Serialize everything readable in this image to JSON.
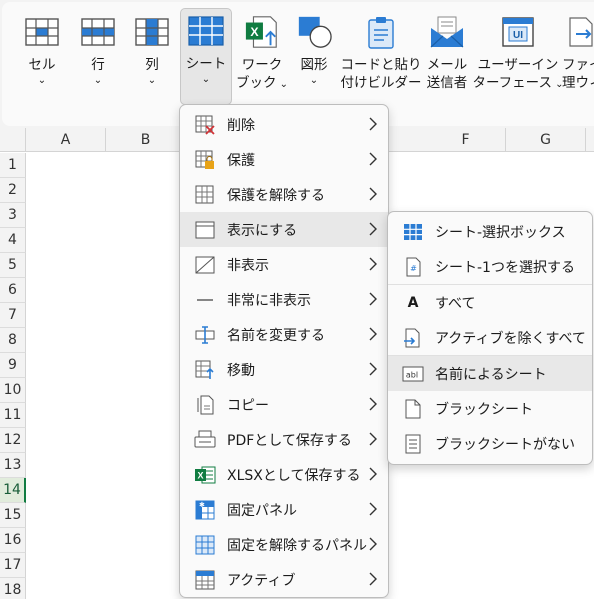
{
  "ribbon": {
    "buttons": [
      {
        "label": "セル",
        "has_dropdown": true
      },
      {
        "label": "行",
        "has_dropdown": true
      },
      {
        "label": "列",
        "has_dropdown": true
      },
      {
        "label": "シート",
        "has_dropdown": true,
        "active": true
      },
      {
        "label1": "ワーク",
        "label2": "ブック",
        "has_dropdown": true
      },
      {
        "label": "図形",
        "has_dropdown": true
      },
      {
        "label1": "コードと貼り",
        "label2": "付けビルダー"
      },
      {
        "label1": "メール",
        "label2": "送信者"
      },
      {
        "label1": "ユーザーイン",
        "label2": "ターフェース",
        "has_dropdown": true
      },
      {
        "label1": "ファイ",
        "label2": "理ウィ"
      }
    ]
  },
  "grid": {
    "columns": [
      "A",
      "B",
      "",
      "",
      "F",
      "G"
    ],
    "rows": [
      "1",
      "2",
      "3",
      "4",
      "5",
      "6",
      "7",
      "8",
      "9",
      "10",
      "11",
      "12",
      "13",
      "14",
      "15",
      "16",
      "17",
      "18"
    ],
    "selected_row": "14"
  },
  "sheet_menu": {
    "items": [
      {
        "label": "削除",
        "icon": "delete-sheet-icon"
      },
      {
        "label": "保護",
        "icon": "protect-sheet-icon"
      },
      {
        "label": "保護を解除する",
        "icon": "unprotect-sheet-icon"
      },
      {
        "label": "表示にする",
        "icon": "show-sheet-icon",
        "highlighted": true
      },
      {
        "label": "非表示",
        "icon": "hide-sheet-icon"
      },
      {
        "label": "非常に非表示",
        "icon": "very-hidden-icon"
      },
      {
        "label": "名前を変更する",
        "icon": "rename-icon"
      },
      {
        "label": "移動",
        "icon": "move-icon"
      },
      {
        "label": "コピー",
        "icon": "copy-icon"
      },
      {
        "label": "PDFとして保存する",
        "icon": "pdf-save-icon"
      },
      {
        "label": "XLSXとして保存する",
        "icon": "xlsx-save-icon"
      },
      {
        "label": "固定パネル",
        "icon": "freeze-panes-icon"
      },
      {
        "label": "固定を解除するパネル",
        "icon": "unfreeze-panes-icon"
      },
      {
        "label": "アクティブ",
        "icon": "active-sheet-icon"
      }
    ]
  },
  "show_submenu": {
    "items": [
      {
        "label": "シート-選択ボックス",
        "icon": "sheet-select-box-icon"
      },
      {
        "label": "シート-1つを選択する",
        "icon": "select-one-sheet-icon"
      },
      {
        "label": "すべて",
        "icon": "all-letter-a-icon"
      },
      {
        "label": "アクティブを除くすべて",
        "icon": "all-except-active-icon"
      },
      {
        "label": "名前によるシート",
        "icon": "by-name-icon",
        "highlighted": true
      },
      {
        "label": "ブラックシート",
        "icon": "blank-sheet-icon"
      },
      {
        "label": "ブラックシートがない",
        "icon": "no-blank-sheet-icon"
      }
    ]
  },
  "colors": {
    "accent_green": "#107c41",
    "excel_blue": "#2b7cd3"
  }
}
